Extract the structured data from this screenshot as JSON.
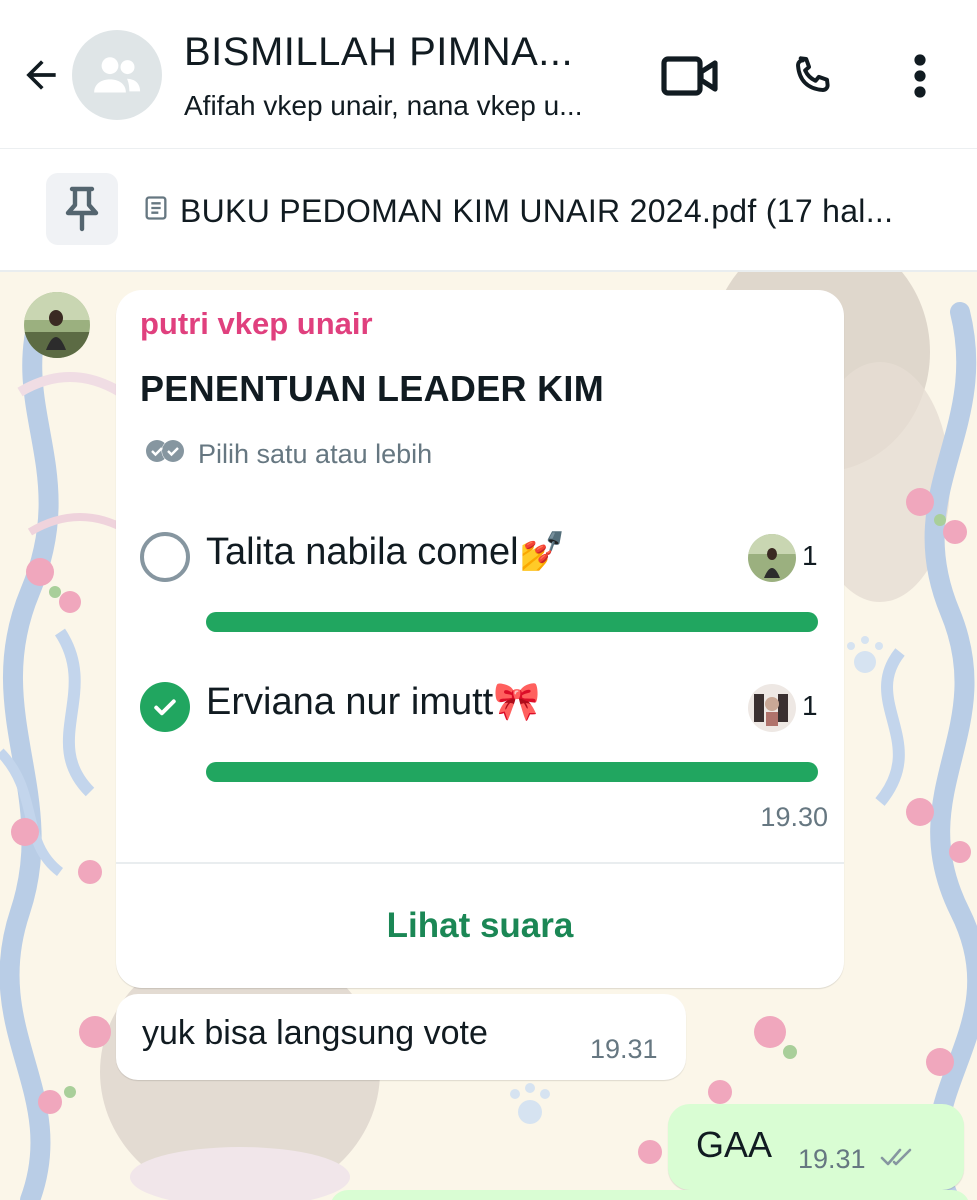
{
  "header": {
    "title": "BISMILLAH PIMNA...",
    "subtitle": "Afifah vkep unair, nana vkep u...",
    "icons": [
      "back-arrow-icon",
      "group-avatar-icon",
      "video-call-icon",
      "voice-call-icon",
      "more-options-icon"
    ]
  },
  "pinned": {
    "text": "BUKU PEDOMAN KIM UNAIR 2024.pdf (17 hal...",
    "icons": [
      "pin-icon",
      "document-icon"
    ]
  },
  "poll": {
    "sender": "putri vkep unair",
    "question": "PENENTUAN LEADER KIM",
    "hint": "Pilih satu atau lebih",
    "options": [
      {
        "label": "Talita nabila comel💅",
        "votes": "1",
        "selected": false,
        "fill": 1.0
      },
      {
        "label": "Erviana nur imutt🎀",
        "votes": "1",
        "selected": true,
        "fill": 1.0
      }
    ],
    "time": "19.30",
    "view_votes_label": "Lihat suara"
  },
  "messages": [
    {
      "direction": "in",
      "text": "yuk bisa langsung vote",
      "time": "19.31"
    },
    {
      "direction": "out",
      "text": "GAA",
      "time": "19.31",
      "status": "read-ticks-icon"
    }
  ],
  "colors": {
    "sender_name": "#e0407e",
    "accent_green": "#21a660",
    "view_votes": "#1b8755",
    "outgoing_bubble": "#d9fdd3",
    "wallpaper": "#fbf6e9"
  }
}
